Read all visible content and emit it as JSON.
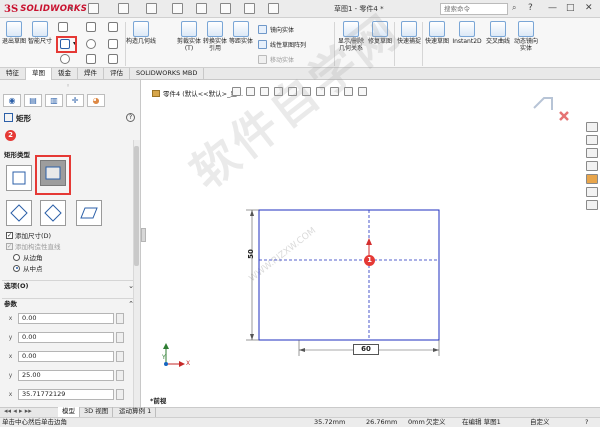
{
  "app": {
    "logo_ds": "3S",
    "logo_name": "SOLIDWORKS"
  },
  "title_bar": {
    "doc_title": "草图1 - 零件4 *",
    "search_placeholder": "搜索命令"
  },
  "ribbon": {
    "exit_sketch": "退出草图",
    "smart_dim": "智能尺寸",
    "trim": "剪裁实体(T)",
    "convert": "转换实体引用",
    "offset": "等距实体",
    "construct": "构造几何线",
    "mirror": "镜向实体",
    "linear_pattern": "线性草图阵列",
    "move": "移动实体",
    "display_delete": "显示/删除几何关系",
    "repair": "修复草图",
    "quick_snaps": "快速捕捉",
    "rapid_sketch": "快速草图",
    "instant2d": "Instant2D",
    "intersection": "交叉曲线",
    "dynamic_mirror": "动态镜向实体"
  },
  "tabs": [
    "特征",
    "草图",
    "钣金",
    "焊件",
    "评估",
    "SOLIDWORKS MBD"
  ],
  "active_tab": 1,
  "panel": {
    "title": "矩形",
    "step1_badge": "1",
    "step2_badge": "2",
    "help": "?",
    "rect_type_header": "矩形类型",
    "add_dim": "添加尺寸(D)",
    "add_construct": "添加构造性直线",
    "from_corner": "从边角",
    "from_mid": "从中点",
    "options_header": "选项(O)",
    "params_header": "参数",
    "params": [
      "0.00",
      "0.00",
      "0.00",
      "25.00",
      "35.71772129"
    ],
    "param_icons": [
      "x",
      "y",
      "x",
      "y",
      "x"
    ]
  },
  "graphics": {
    "crumb": "零件4 (默认<<默认>_显...",
    "dim_width": "60",
    "dim_height": "50",
    "view_label": "*前视"
  },
  "model_tabs": [
    "模型",
    "3D 视图",
    "运动算例 1"
  ],
  "status": {
    "hint": "单击中心然后单击边角",
    "x": "35.72mm",
    "y": "26.76mm",
    "z": "0mm",
    "state": "欠定义",
    "editing": "在编辑 草图1",
    "custom": "自定义"
  },
  "watermark": {
    "text": "软件自学网",
    "url": "WWW.RJZXW.COM"
  },
  "colors": {
    "accent_red": "#e53935",
    "sketch_blue": "#1f2fbf",
    "brand": "#c8102e"
  }
}
